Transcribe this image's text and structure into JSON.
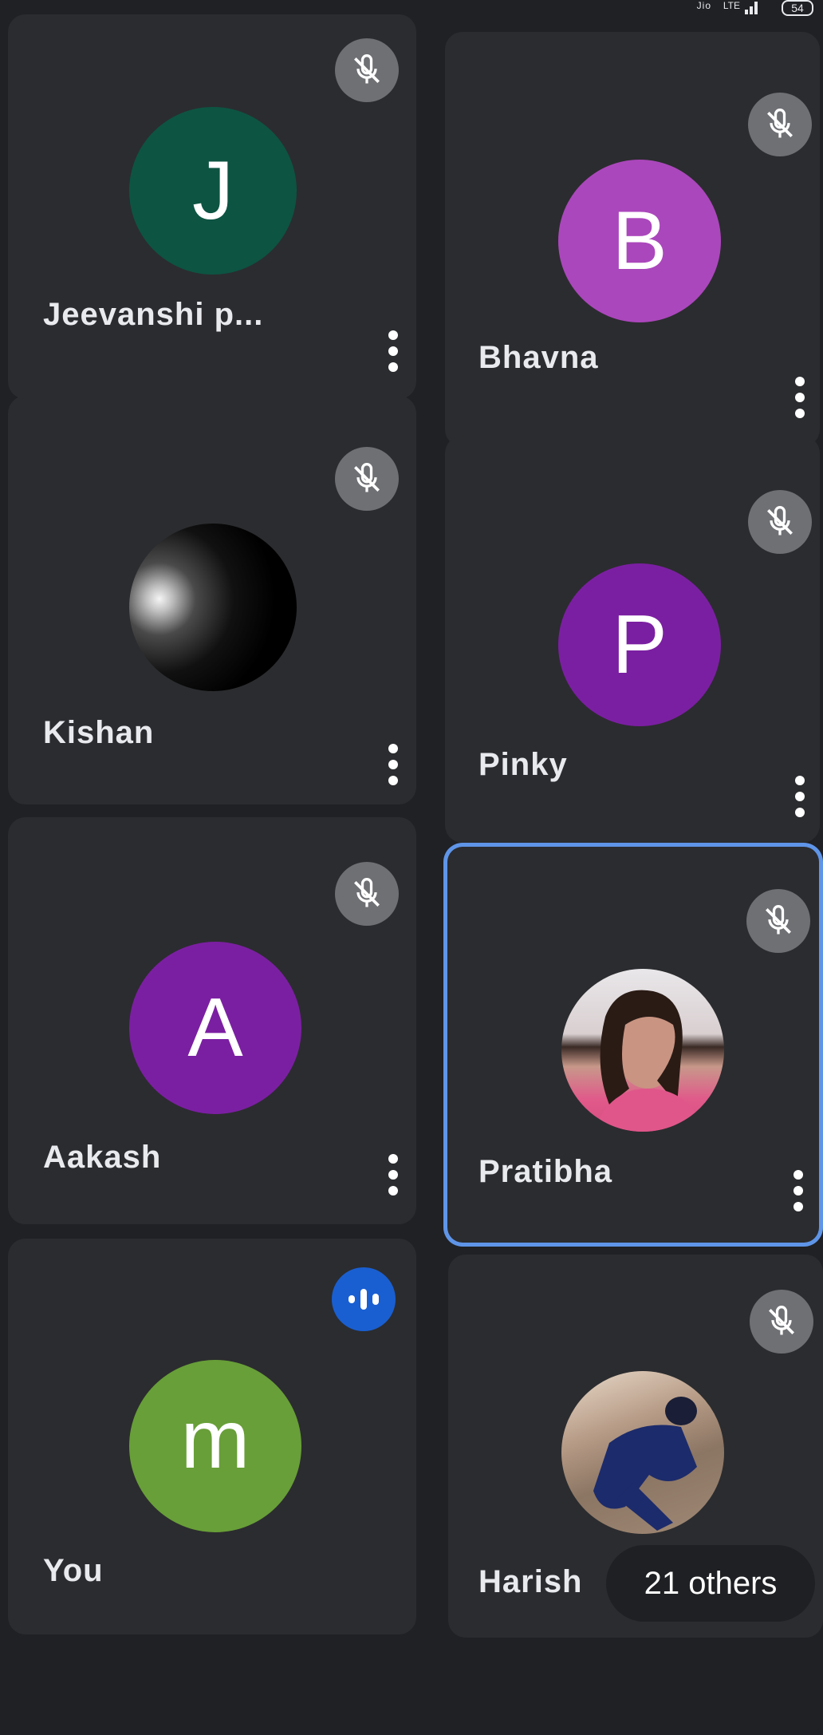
{
  "status_bar": {
    "network": "Jio",
    "lte": "LTE",
    "battery": "54"
  },
  "participants": [
    {
      "name": "Jeevanshi p...",
      "initial": "J",
      "avatar_color": "#0d5443",
      "muted": true
    },
    {
      "name": "Bhavna",
      "initial": "B",
      "avatar_color": "#ab47bc",
      "muted": true
    },
    {
      "name": "Kishan",
      "initial": "",
      "avatar_color": "#000000",
      "muted": true,
      "photo": true
    },
    {
      "name": "Pinky",
      "initial": "P",
      "avatar_color": "#7b1fa2",
      "muted": true
    },
    {
      "name": "Aakash",
      "initial": "A",
      "avatar_color": "#7b1fa2",
      "muted": true
    },
    {
      "name": "Pratibha",
      "initial": "",
      "avatar_color": "#f3d9d6",
      "muted": true,
      "photo": true,
      "active_speaker": true
    },
    {
      "name": "You",
      "initial": "m",
      "avatar_color": "#689f38",
      "muted": false,
      "speaking": true
    },
    {
      "name": "Harish",
      "initial": "",
      "avatar_color": "#9d8b7a",
      "muted": true,
      "photo": true
    }
  ],
  "others_chip": {
    "label": "21 others"
  },
  "colors": {
    "background": "#202124",
    "tile": "#2b2c2f",
    "active_border": "#5f95e8",
    "speaking_badge": "#1a5fd1",
    "mute_badge": "#6f7074"
  }
}
